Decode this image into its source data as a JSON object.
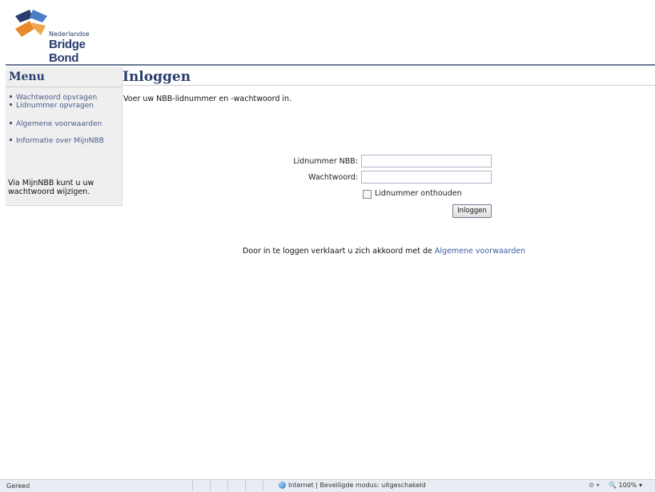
{
  "header": {
    "logo_small": "Nederlandse",
    "logo_big": "Bridge Bond"
  },
  "sidebar": {
    "title": "Menu",
    "items": [
      {
        "label": "Wachtwoord opvragen"
      },
      {
        "label": "Lidnummer opvragen"
      },
      {
        "label": "Algemene voorwaarden"
      },
      {
        "label": "Informatie over MijnNBB"
      }
    ],
    "note_line1": "Via MijnNBB kunt u uw",
    "note_line2": "wachtwoord wijzigen."
  },
  "main": {
    "title": "Inloggen",
    "intro": "Voer uw NBB-lidnummer en -wachtwoord in.",
    "form": {
      "lidnummer_label": "Lidnummer NBB:",
      "lidnummer_value": "",
      "wachtwoord_label": "Wachtwoord:",
      "wachtwoord_value": "",
      "remember_label": "Lidnummer onthouden",
      "remember_checked": false,
      "submit_label": "Inloggen"
    },
    "agree_text": "Door in te loggen verklaart u zich akkoord met de",
    "agree_link": "Algemene voorwaarden"
  },
  "statusbar": {
    "status": "Gereed",
    "zone": "Internet | Beveiligde modus: uitgeschakeld",
    "zoom": "100%"
  },
  "colors": {
    "brand_navy": "#2a3d6e",
    "brand_orange": "#e8892a",
    "link": "#3e5a9e"
  }
}
